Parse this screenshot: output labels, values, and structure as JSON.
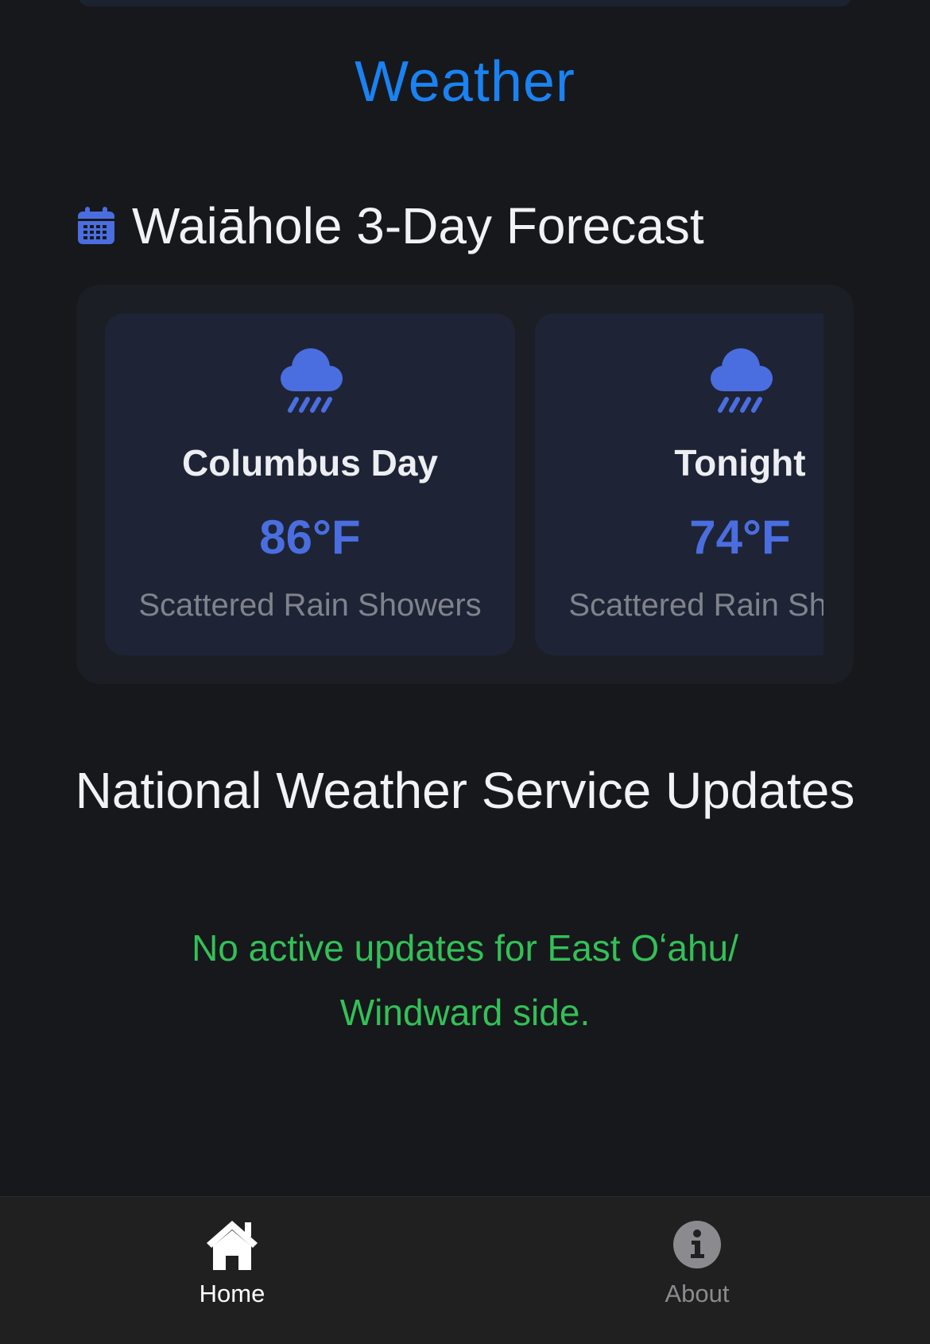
{
  "section_title": "Weather",
  "forecast": {
    "title": "Waiāhole 3-Day Forecast",
    "icon": "calendar-icon",
    "cards": [
      {
        "name": "Columbus Day",
        "temperature": "86°F",
        "short_forecast": "Scattered Rain Showers",
        "icon": "cloud-rain-icon"
      },
      {
        "name": "Tonight",
        "temperature": "74°F",
        "short_forecast": "Scattered Rain Showers",
        "icon": "cloud-rain-icon"
      }
    ]
  },
  "nws": {
    "title": "National Weather Service Updates",
    "message": "No active updates for East Oʻahu/ Windward side."
  },
  "tab_bar": {
    "tabs": [
      {
        "label": "Home",
        "icon": "home-icon",
        "active": true
      },
      {
        "label": "About",
        "icon": "info-icon",
        "active": false
      }
    ]
  },
  "colors": {
    "background": "#17181b",
    "accent_blue": "#1a82f2",
    "temperature_blue": "#4a6ee0",
    "success_green": "#33c058",
    "card_background": "#1e2436",
    "tab_bar_background": "#202021"
  }
}
